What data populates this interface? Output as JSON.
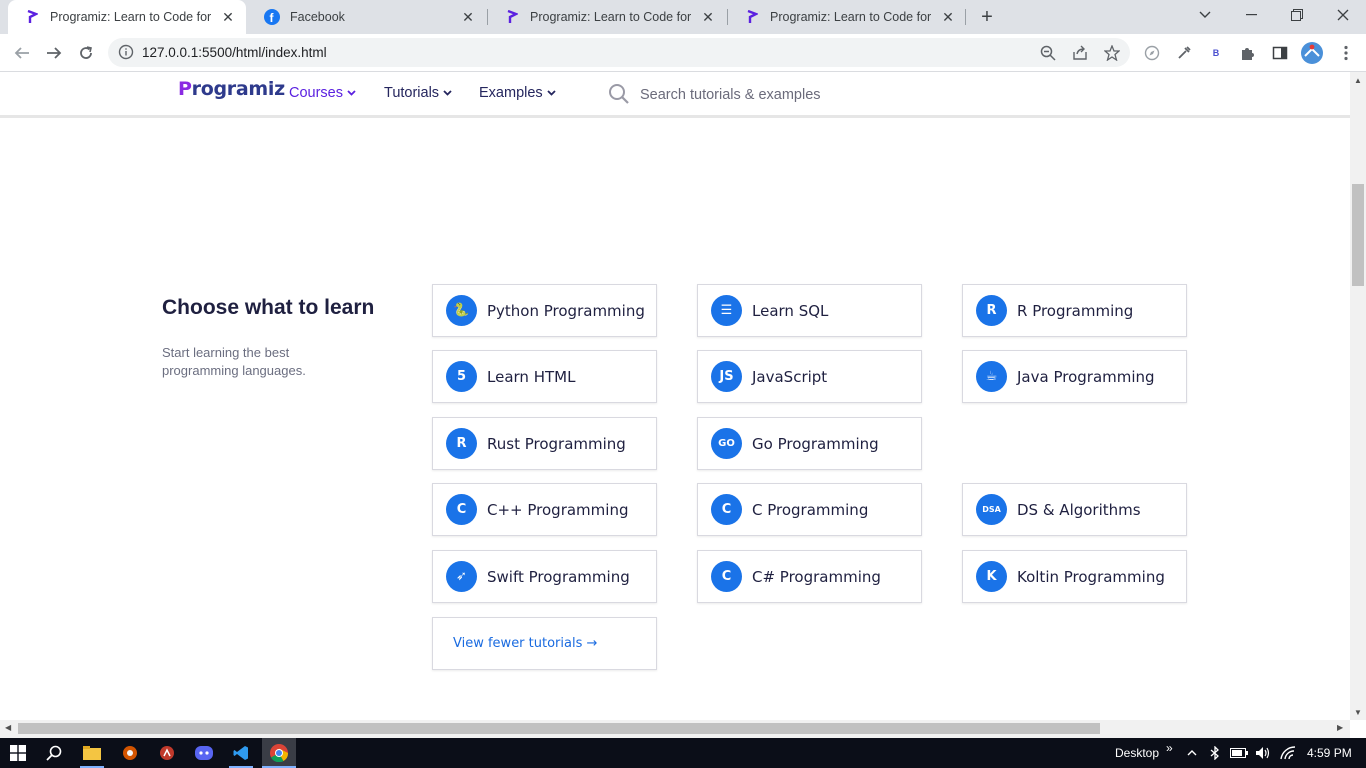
{
  "browser": {
    "tabs": [
      {
        "title": "Programiz: Learn to Code for Free",
        "favicon": "programiz-icon",
        "active": true
      },
      {
        "title": "Facebook",
        "favicon": "facebook-icon",
        "active": false
      },
      {
        "title": "Programiz: Learn to Code for Free",
        "favicon": "programiz-icon",
        "active": false
      },
      {
        "title": "Programiz: Learn to Code for Free",
        "favicon": "programiz-icon",
        "active": false
      }
    ],
    "address": "127.0.0.1:5500/html/index.html",
    "profile_badge": "B"
  },
  "site": {
    "logo": "rogramiz",
    "logo_first": "P",
    "nav": {
      "courses": "Courses",
      "tutorials": "Tutorials",
      "examples": "Examples"
    },
    "search_placeholder": "Search tutorials & examples"
  },
  "section": {
    "heading": "Choose what to learn",
    "subtext": "Start learning the best programming languages.",
    "cards": [
      {
        "label": "Python Programming",
        "icon": "python-icon",
        "glyph": "🐍"
      },
      {
        "label": "Learn SQL",
        "icon": "database-icon",
        "glyph": "☰"
      },
      {
        "label": "R Programming",
        "icon": "r-icon",
        "glyph": "R"
      },
      {
        "label": "Learn HTML",
        "icon": "html5-icon",
        "glyph": "5"
      },
      {
        "label": "JavaScript",
        "icon": "javascript-icon",
        "glyph": "JS"
      },
      {
        "label": "Java Programming",
        "icon": "java-icon",
        "glyph": "☕"
      },
      {
        "label": "Rust Programming",
        "icon": "rust-icon",
        "glyph": "R"
      },
      {
        "label": "Go Programming",
        "icon": "go-icon",
        "glyph": "GO"
      },
      {
        "label": "C++ Programming",
        "icon": "cpp-icon",
        "glyph": "C"
      },
      {
        "label": "C Programming",
        "icon": "c-icon",
        "glyph": "C"
      },
      {
        "label": "DS & Algorithms",
        "icon": "dsa-icon",
        "glyph": "DSA"
      },
      {
        "label": "Swift Programming",
        "icon": "swift-icon",
        "glyph": "➶"
      },
      {
        "label": "C# Programming",
        "icon": "csharp-icon",
        "glyph": "C"
      },
      {
        "label": "Koltin Programming",
        "icon": "kotlin-icon",
        "glyph": "K"
      }
    ],
    "more_link": "View fewer tutorials →"
  },
  "taskbar": {
    "desktop_label": "Desktop",
    "overflow": "»",
    "time": "4:59 PM"
  },
  "colors": {
    "accent": "#1a73e8",
    "brand_purple": "#5b21e0",
    "heading": "#1f2040"
  }
}
